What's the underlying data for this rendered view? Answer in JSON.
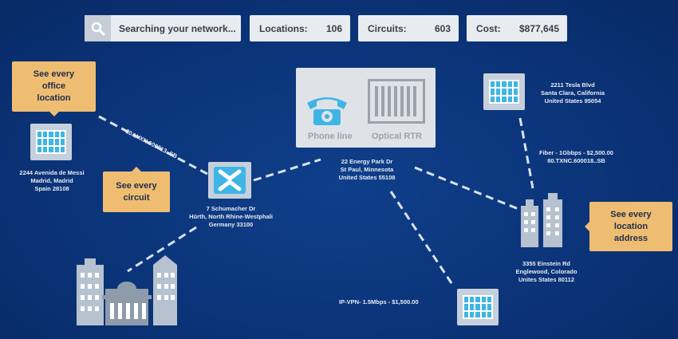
{
  "topbar": {
    "search_text": "Searching your network...",
    "locations_label": "Locations:",
    "locations_value": "106",
    "circuits_label": "Circuits:",
    "circuits_value": "603",
    "cost_label": "Cost:",
    "cost_value": "$877,645"
  },
  "callouts": {
    "office": "See every office location",
    "circuit": "See every circuit",
    "address": "See every location address"
  },
  "panel": {
    "phone_label": "Phone line",
    "optical_label": "Optical RTR"
  },
  "locations": {
    "madrid": [
      "2244 Avenida de Messi",
      "Madrid, Madrid",
      "Spain 28108"
    ],
    "hurth": [
      "7 Schumacher Dr",
      "Hürth, North Rhine-Westphali",
      "Germany 33100"
    ],
    "stpaul": [
      "22 Energy Park Dr",
      "St Paul, Minnesota",
      "United States 55108"
    ],
    "santaclara": [
      "2211  Tesla Blvd",
      "Santa Clara, California",
      "United States 95054"
    ],
    "englewood": [
      "3355 Einstein Rd",
      "Englewood, Colorado",
      "Unites States 80112"
    ]
  },
  "circuit_labels": {
    "madrid_link": "80.LVXN.600013..SB",
    "fiber_line": "Fiber - 1Gbbps - $2,500.00",
    "fiber_id": "80.TXNC.600018..SB",
    "ipvpn": "IP-VPN- 1.5Mbps - $1,500.00"
  },
  "colors": {
    "background": "#0b3479",
    "callout": "#efbd72",
    "accent": "#3fb5e6",
    "tile": "#c6d0dc"
  },
  "icons": [
    "search-icon",
    "building-icon",
    "network-switch-icon",
    "phone-icon",
    "optical-router-icon",
    "city-skyline-icon",
    "office-towers-icon"
  ]
}
